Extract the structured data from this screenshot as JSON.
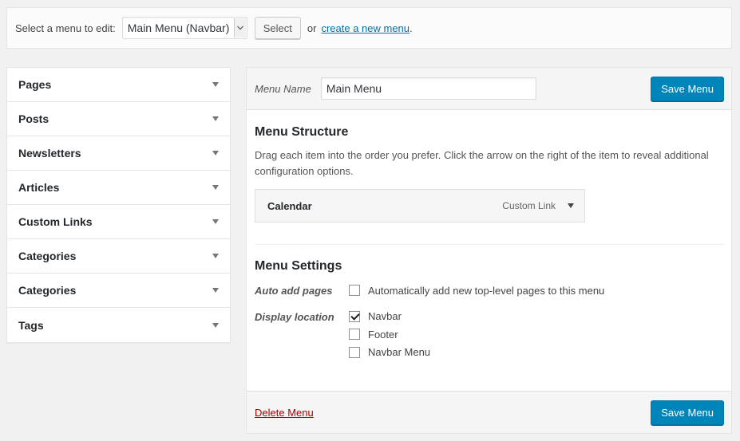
{
  "topbar": {
    "select_label": "Select a menu to edit:",
    "selected_menu": "Main Menu (Navbar)",
    "select_button": "Select",
    "or_text": "or",
    "create_link": "create a new menu",
    "create_link_suffix": "."
  },
  "sidebar": {
    "items": [
      {
        "label": "Pages"
      },
      {
        "label": "Posts"
      },
      {
        "label": "Newsletters"
      },
      {
        "label": "Articles"
      },
      {
        "label": "Custom Links"
      },
      {
        "label": "Categories"
      },
      {
        "label": "Categories"
      },
      {
        "label": "Tags"
      }
    ]
  },
  "editor": {
    "menu_name_label": "Menu Name",
    "menu_name_value": "Main Menu",
    "save_button": "Save Menu",
    "structure_title": "Menu Structure",
    "structure_desc": "Drag each item into the order you prefer. Click the arrow on the right of the item to reveal additional configuration options.",
    "menu_items": [
      {
        "title": "Calendar",
        "type": "Custom Link"
      }
    ],
    "settings_title": "Menu Settings",
    "auto_add_label": "Auto add pages",
    "auto_add_option": "Automatically add new top-level pages to this menu",
    "auto_add_checked": false,
    "display_location_label": "Display location",
    "locations": [
      {
        "label": "Navbar",
        "checked": true
      },
      {
        "label": "Footer",
        "checked": false
      },
      {
        "label": "Navbar Menu",
        "checked": false
      }
    ],
    "delete_link": "Delete Menu",
    "save_button_footer": "Save Menu"
  },
  "colors": {
    "primary_button": "#0085ba",
    "link": "#0073aa",
    "delete_link": "#aa0000"
  }
}
